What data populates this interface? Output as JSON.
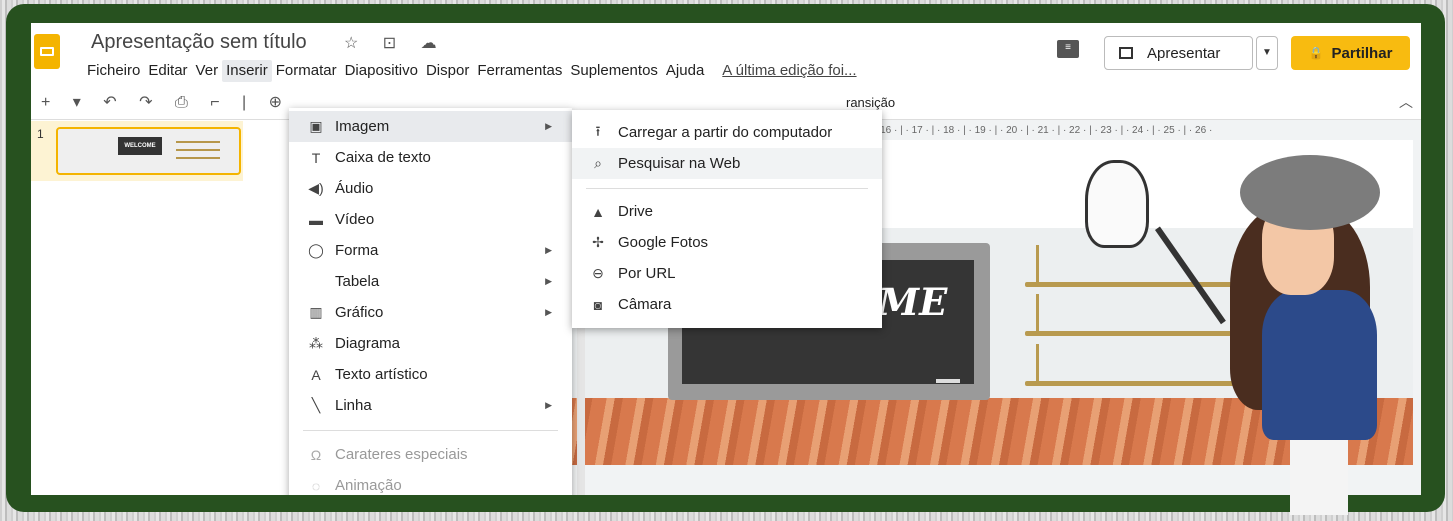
{
  "window": {
    "title": "Apresentação sem título",
    "title_icons": "☆ ⊡ ☁"
  },
  "menubar": {
    "items": [
      "Ficheiro",
      "Editar",
      "Ver",
      "Inserir",
      "Formatar",
      "Diapositivo",
      "Dispor",
      "Ferramentas",
      "Suplementos",
      "Ajuda"
    ],
    "last_edit": "A última edição foi..."
  },
  "header": {
    "present_label": "Apresentar",
    "share_label": "Partilhar"
  },
  "toolbar": {
    "transition_label": "ransição"
  },
  "filmstrip": {
    "slide_number": "1",
    "thumb_text": "WELCOME"
  },
  "ruler": {
    "ticks": "· 14 · | · 15 · | · 16 · | · 17 · | · 18 · | · 19 · | · 20 · | · 21 · | · 22 · | · 23 · | · 24 · | · 25 · | · 26 ·"
  },
  "slide": {
    "board_text": "WELCOME"
  },
  "insert_menu": {
    "items": [
      {
        "label": "Imagem",
        "icon": "image-icon",
        "submenu": true
      },
      {
        "label": "Caixa de texto",
        "icon": "text-box-icon",
        "submenu": false
      },
      {
        "label": "Áudio",
        "icon": "audio-icon",
        "submenu": false
      },
      {
        "label": "Vídeo",
        "icon": "video-icon",
        "submenu": false
      },
      {
        "label": "Forma",
        "icon": "shape-icon",
        "submenu": true
      },
      {
        "label": "Tabela",
        "icon": "",
        "submenu": true
      },
      {
        "label": "Gráfico",
        "icon": "chart-icon",
        "submenu": true
      },
      {
        "label": "Diagrama",
        "icon": "diagram-icon",
        "submenu": false
      },
      {
        "label": "Texto artístico",
        "icon": "word-art-icon",
        "submenu": false
      },
      {
        "label": "Linha",
        "icon": "line-icon",
        "submenu": true
      },
      {
        "label": "Carateres especiais",
        "icon": "omega-icon",
        "submenu": false
      },
      {
        "label": "Animação",
        "icon": "animation-icon",
        "submenu": false
      }
    ]
  },
  "image_menu": {
    "items": [
      {
        "label": "Carregar a partir do computador",
        "icon": "upload-icon"
      },
      {
        "label": "Pesquisar na Web",
        "icon": "search-icon"
      },
      {
        "label": "Drive",
        "icon": "drive-icon"
      },
      {
        "label": "Google Fotos",
        "icon": "google-photos-icon"
      },
      {
        "label": "Por URL",
        "icon": "link-icon"
      },
      {
        "label": "Câmara",
        "icon": "camera-icon"
      }
    ]
  },
  "colors": {
    "frame": "#27511f",
    "accent": "#f4b400",
    "share_button": "#f8bb10"
  }
}
